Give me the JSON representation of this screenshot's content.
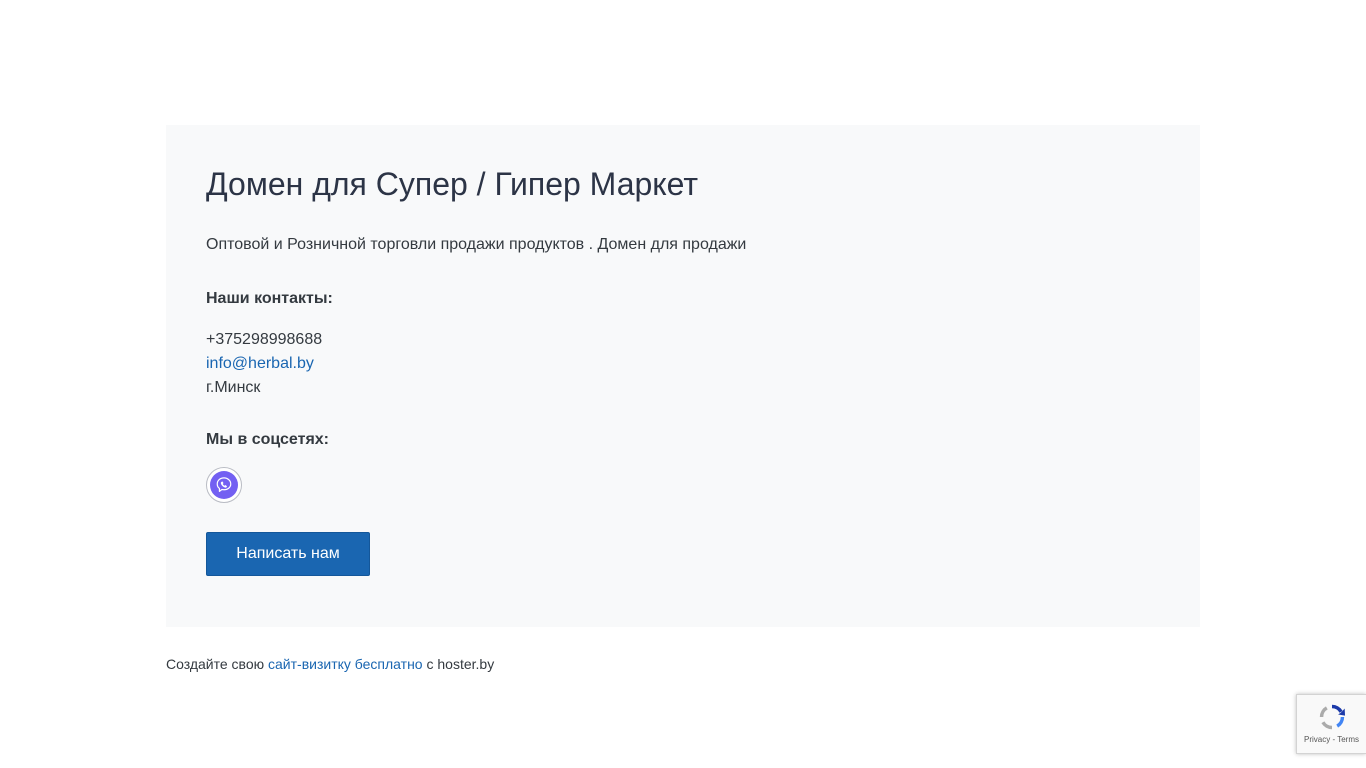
{
  "card": {
    "title": "Домен для Супер / Гипер Маркет",
    "subtitle": "Оптовой и Розничной торговли продажи продуктов . Домен для продажи",
    "contacts_label": "Наши контакты:",
    "phone": "+375298998688",
    "email": "info@herbal.by",
    "city": "г.Минск",
    "social_label": "Мы в соцсетях:",
    "social_icon": "viber-icon",
    "write_button": "Написать нам"
  },
  "footer": {
    "prefix": "Создайте свою",
    "link": "сайт-визитку бесплатно",
    "suffix": "с hoster.by"
  },
  "recaptcha": {
    "privacy": "Privacy",
    "separator": " - ",
    "terms": "Terms"
  },
  "colors": {
    "accent": "#1a66b1",
    "card_background": "#f8f9fa",
    "viber": "#7360f2"
  }
}
